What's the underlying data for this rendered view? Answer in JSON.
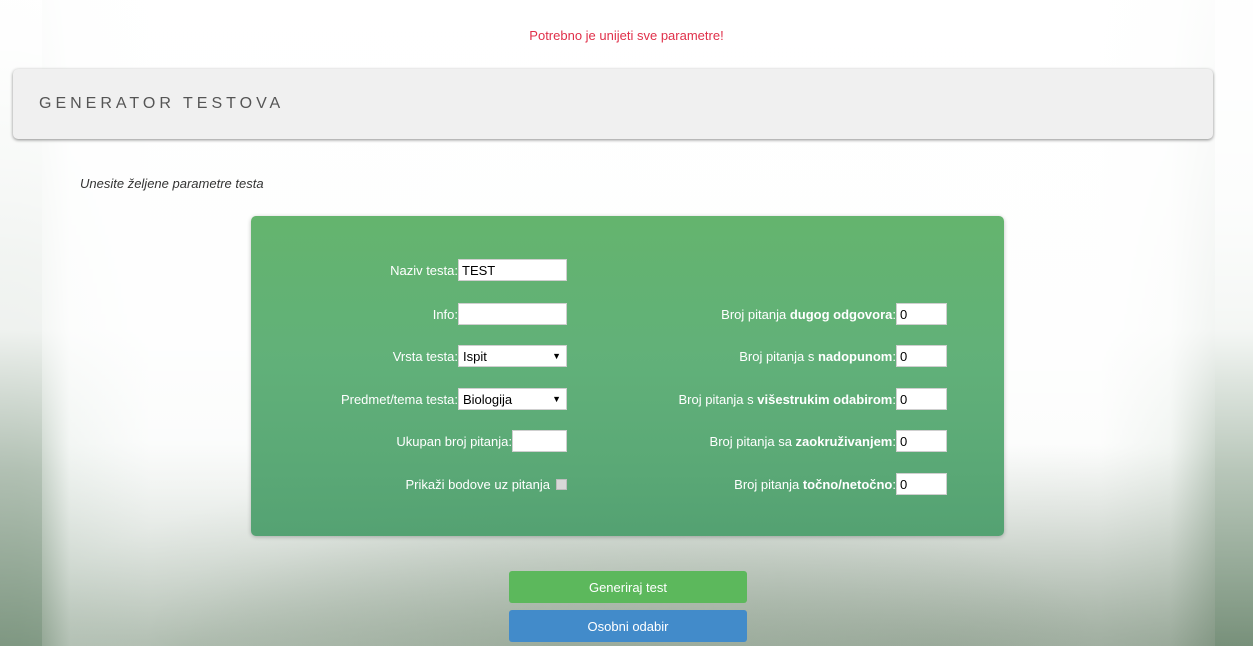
{
  "error_message": "Potrebno je unijeti sve parametre!",
  "header": {
    "title": "GENERATOR TESTOVA"
  },
  "subtitle": "Unesite željene parametre testa",
  "form": {
    "naziv": {
      "label": "Naziv testa:",
      "value": "TEST"
    },
    "info": {
      "label": "Info:",
      "value": ""
    },
    "vrsta": {
      "label": "Vrsta testa:",
      "selected": "Ispit"
    },
    "predmet": {
      "label": "Predmet/tema testa:",
      "selected": "Biologija"
    },
    "ukupan": {
      "label": "Ukupan broj pitanja:",
      "value": ""
    },
    "bodovi": {
      "label": "Prikaži bodove uz pitanja",
      "checked": false
    },
    "dugog": {
      "prefix": "Broj pitanja ",
      "bold": "dugog odgovora",
      "suffix": ":",
      "value": "0"
    },
    "nadopunom": {
      "prefix": "Broj pitanja s ",
      "bold": "nadopunom",
      "suffix": ":",
      "value": "0"
    },
    "visestrukim": {
      "prefix": "Broj pitanja s ",
      "bold": "višestrukim odabirom",
      "suffix": ":",
      "value": "0"
    },
    "zaokruzivanjem": {
      "prefix": "Broj pitanja sa ",
      "bold": "zaokruživanjem",
      "suffix": ":",
      "value": "0"
    },
    "tocno": {
      "prefix": "Broj pitanja ",
      "bold": "točno/netočno",
      "suffix": ":",
      "value": "0"
    }
  },
  "buttons": {
    "generate": "Generiraj test",
    "personal": "Osobni odabir"
  },
  "icons": {
    "select_arrow": "dropdown-arrow-icon"
  },
  "colors": {
    "error": "#e0304a",
    "panel": "#5cb066",
    "generate": "#5cb85c",
    "personal": "#428bca"
  }
}
